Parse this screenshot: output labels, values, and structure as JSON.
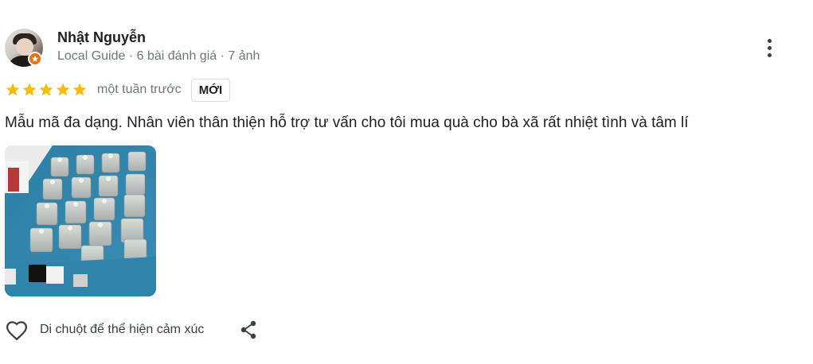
{
  "reviewer": {
    "name": "Nhật Nguyễn",
    "meta": "Local Guide · 6 bài đánh giá · 7 ảnh",
    "avatar_icon": "user-avatar",
    "badge_icon": "local-guide-star-icon",
    "badge_color": "#e8710a"
  },
  "menu": {
    "icon": "more-vert-icon"
  },
  "review": {
    "rating": 5,
    "rating_max": 5,
    "star_color": "#fbbc04",
    "time": "một tuần trước",
    "badge": "MỚI",
    "text": "Mẫu mã đa dạng. Nhân viên thân thiện hỗ trợ tư vấn cho tôi mua quà cho bà xã rất nhiệt tình và tâm lí",
    "photos": [
      "jewelry-display-photo"
    ]
  },
  "actions": {
    "react_label": "Di chuột để thể hiện cảm xúc",
    "react_icon": "heart-outline-icon",
    "share_icon": "share-icon"
  }
}
